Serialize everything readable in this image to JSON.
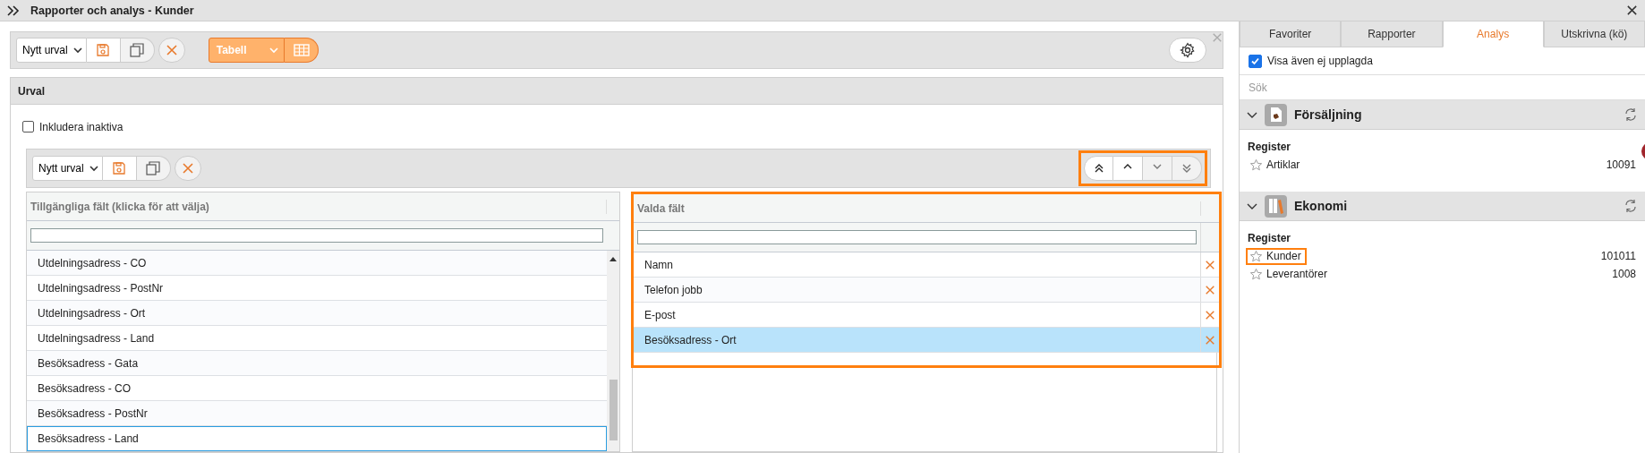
{
  "window": {
    "title": "Rapporter och analys - Kunder"
  },
  "toolbar": {
    "selection": "Nytt urval",
    "view": "Tabell"
  },
  "urval": {
    "title": "Urval",
    "include_inactive": {
      "label": "Inkludera inaktiva",
      "checked": false
    },
    "toolbar": {
      "selection": "Nytt urval"
    },
    "move_buttons": {
      "highlighted": true,
      "items": [
        {
          "kind": "top",
          "disabled": false
        },
        {
          "kind": "up",
          "disabled": false
        },
        {
          "kind": "down",
          "disabled": true
        },
        {
          "kind": "bottom",
          "disabled": true
        }
      ]
    },
    "available": {
      "header": "Tillgängliga fält (klicka för att välja)",
      "rows": [
        {
          "label": "Utdelningsadress - CO",
          "selected": false
        },
        {
          "label": "Utdelningsadress - PostNr",
          "selected": false
        },
        {
          "label": "Utdelningsadress - Ort",
          "selected": false
        },
        {
          "label": "Utdelningsadress - Land",
          "selected": false
        },
        {
          "label": "Besöksadress - Gata",
          "selected": false
        },
        {
          "label": "Besöksadress - CO",
          "selected": false
        },
        {
          "label": "Besöksadress - PostNr",
          "selected": false
        },
        {
          "label": "Besöksadress - Land",
          "selected": true
        }
      ]
    },
    "chosen": {
      "header": "Valda fält",
      "highlighted": true,
      "rows": [
        {
          "label": "Namn",
          "selected": false
        },
        {
          "label": "Telefon jobb",
          "selected": false
        },
        {
          "label": "E-post",
          "selected": false
        },
        {
          "label": "Besöksadress - Ort",
          "selected": true
        }
      ]
    }
  },
  "side": {
    "tabs": [
      {
        "label": "Favoriter",
        "selected": false
      },
      {
        "label": "Rapporter",
        "selected": false
      },
      {
        "label": "Analys",
        "selected": true
      },
      {
        "label": "Utskrivna (kö)",
        "selected": false
      }
    ],
    "show_unlisted": {
      "label": "Visa även ej upplagda",
      "checked": true
    },
    "search": {
      "placeholder": "Sök"
    },
    "groups": [
      {
        "title": "Försäljning",
        "kind": "document",
        "expanded": true,
        "subtitle": "Register",
        "items": [
          {
            "label": "Artiklar",
            "count": "10091",
            "highlighted": false
          }
        ]
      },
      {
        "title": "Ekonomi",
        "kind": "binder",
        "expanded": true,
        "subtitle": "Register",
        "items": [
          {
            "label": "Kunder",
            "count": "101011",
            "highlighted": true
          },
          {
            "label": "Leverantörer",
            "count": "1008",
            "highlighted": false
          }
        ]
      }
    ]
  }
}
